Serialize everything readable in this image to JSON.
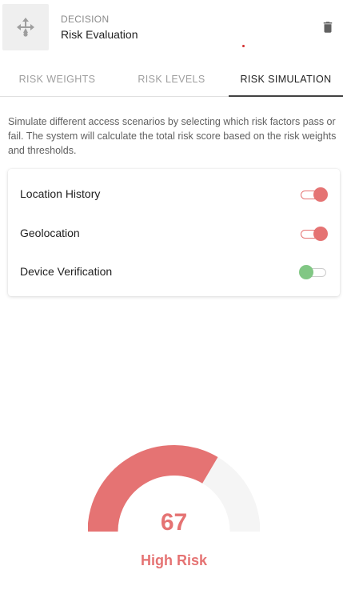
{
  "header": {
    "kicker": "DECISION",
    "title": "Risk Evaluation",
    "node_icon": "move-arrows-icon",
    "delete_icon": "trash-icon"
  },
  "tabs": [
    {
      "label": "RISK WEIGHTS",
      "active": false
    },
    {
      "label": "RISK LEVELS",
      "active": false
    },
    {
      "label": "RISK SIMULATION",
      "active": true
    }
  ],
  "description": "Simulate different access scenarios by selecting which risk factors pass or fail. The system will calculate the total risk score based on the risk weights and thresholds.",
  "factors": [
    {
      "label": "Location History",
      "status": "fail"
    },
    {
      "label": "Geolocation",
      "status": "fail"
    },
    {
      "label": "Device Verification",
      "status": "pass"
    }
  ],
  "result": {
    "score": "67",
    "score_max": 100,
    "level": "High Risk",
    "color": "#e57373"
  },
  "colors": {
    "fail": "#e57373",
    "pass": "#81c784",
    "gauge_track": "#f5f5f5"
  }
}
